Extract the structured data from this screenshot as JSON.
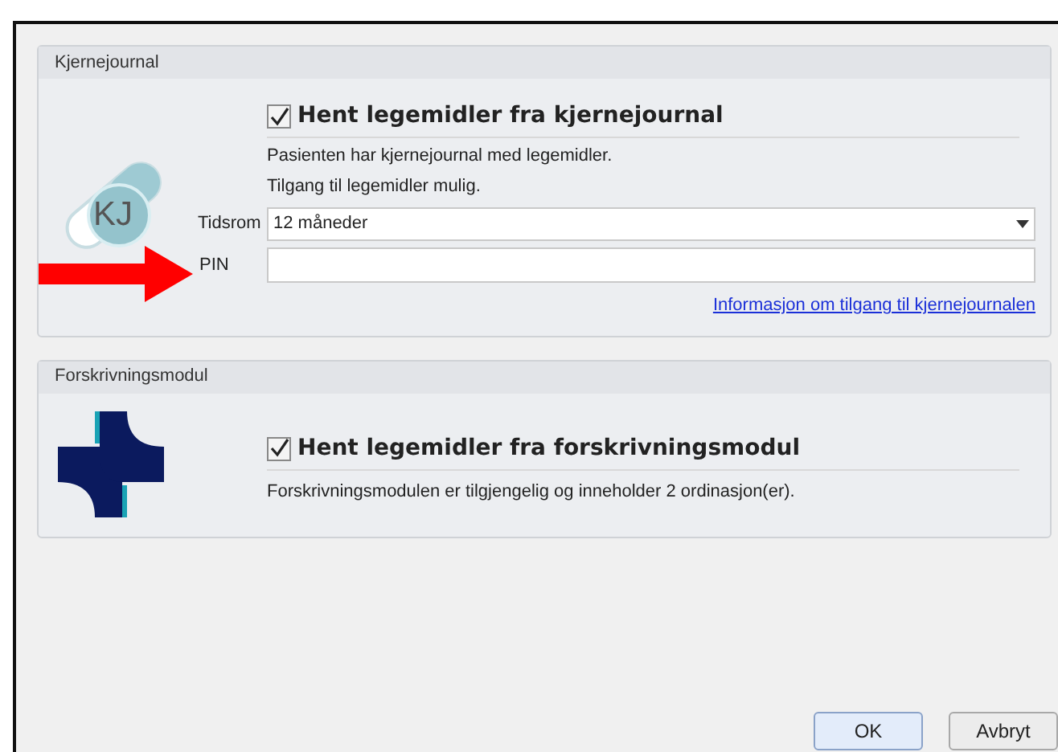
{
  "sections": [
    {
      "kind": "kjernejournal",
      "title": "Kjernejournal",
      "checkbox": {
        "label": "Hent legemidler fra kjernejournal",
        "checked": true
      },
      "lines": [
        "Pasienten har kjernejournal med legemidler.",
        "Tilgang til legemidler mulig."
      ],
      "fields": [
        {
          "kind": "dropdown",
          "label": "Tidsrom",
          "value": "12 måneder"
        },
        {
          "kind": "text",
          "label": "PIN"
        }
      ],
      "link": "Informasjon om tilgang til kjernejournalen",
      "logo_text": "KJ"
    },
    {
      "kind": "forskrivning",
      "title": "Forskrivningsmodul",
      "checkbox": {
        "label": "Hent legemidler fra forskrivningsmodul",
        "checked": true
      },
      "lines": [
        "Forskrivningsmodulen er tilgjengelig og inneholder 2 ordinasjon(er)."
      ]
    }
  ],
  "buttons": [
    {
      "label": "OK",
      "selected": true
    },
    {
      "label": "Avbryt",
      "selected": false
    }
  ]
}
